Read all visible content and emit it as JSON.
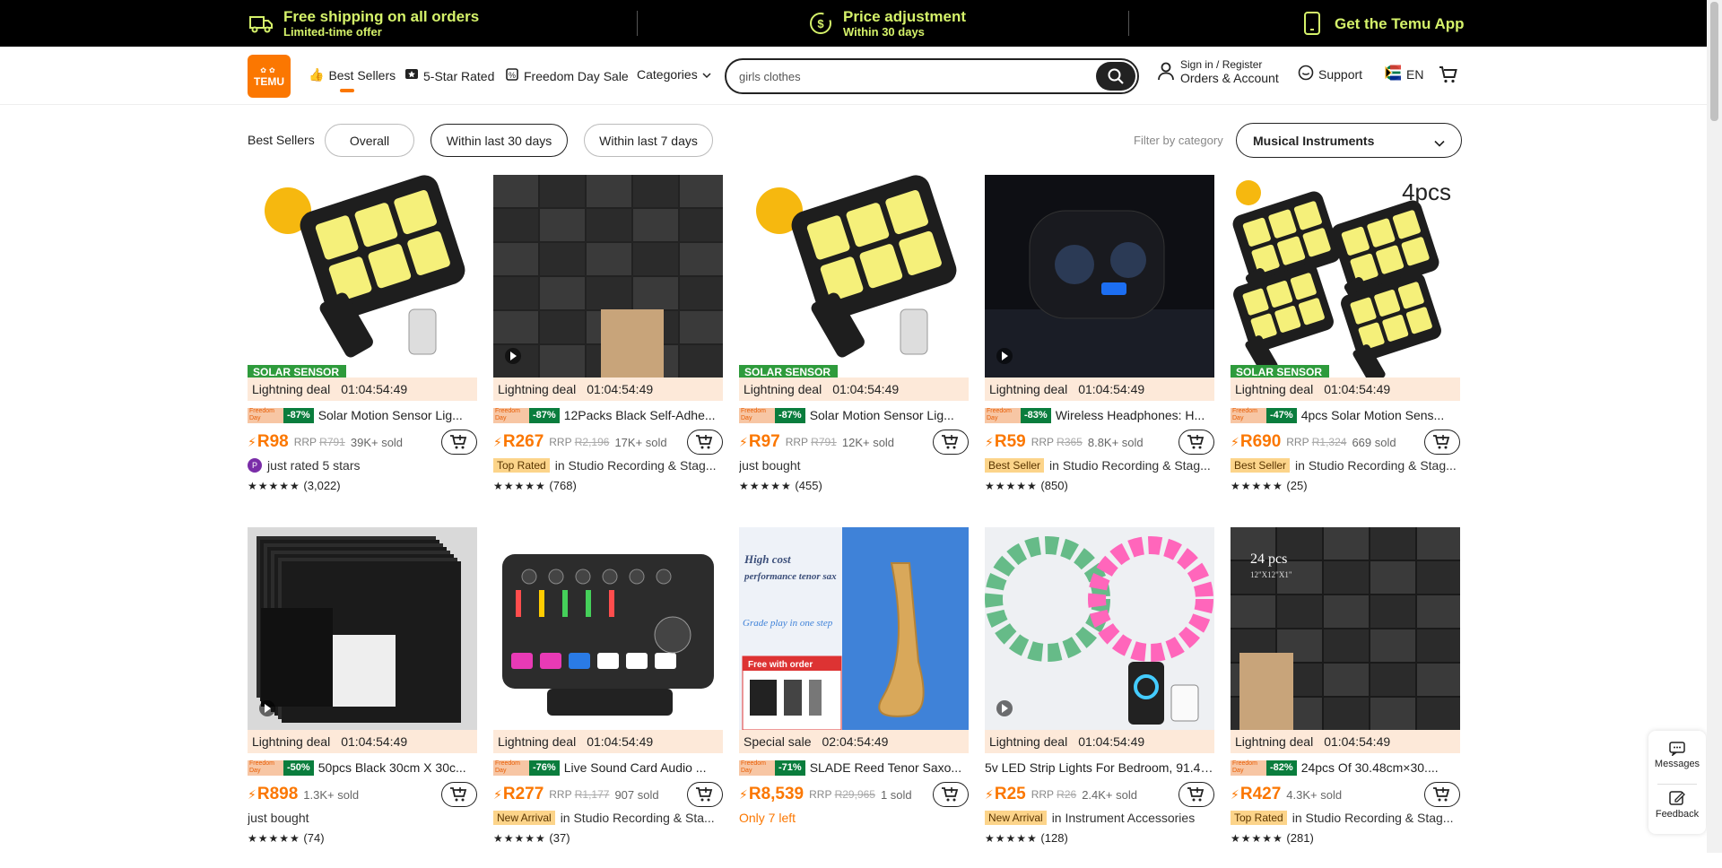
{
  "topbar": {
    "shipping_title": "Free shipping on all orders",
    "shipping_sub": "Limited-time offer",
    "price_title": "Price adjustment",
    "price_sub": "Within 30 days",
    "app": "Get the Temu App"
  },
  "header": {
    "logo_line1": "TE",
    "logo_line2": "MU",
    "nav": [
      "Best Sellers",
      "5-Star Rated",
      "Freedom Day Sale",
      "Categories"
    ],
    "search_value": "girls clothes",
    "signin_line1": "Sign in / Register",
    "signin_line2": "Orders & Account",
    "support": "Support",
    "lang": "EN"
  },
  "filters": {
    "label": "Best Sellers",
    "pills": [
      "Overall",
      "Within last 30 days",
      "Within last 7 days"
    ],
    "filter_label": "Filter by category",
    "category": "Musical Instruments"
  },
  "fd_badge": {
    "line1": "Freedom",
    "line2": "Day"
  },
  "products": [
    {
      "deal": "Lightning deal",
      "timer": "01:04:54:49",
      "disc": "-87%",
      "title": "Solar Motion Sensor Lig...",
      "price": "R98",
      "rrp_label": "RRP",
      "rrp": "R791",
      "sold": "39K+ sold",
      "tag": "",
      "avatar": "P",
      "meta": "just rated 5 stars",
      "stars": "★★★★★",
      "rating": "(3,022)",
      "label": "SOLAR SENSOR"
    },
    {
      "deal": "Lightning deal",
      "timer": "01:04:54:49",
      "disc": "-87%",
      "title": "12Packs Black Self-Adhe...",
      "price": "R267",
      "rrp_label": "RRP",
      "rrp": "R2,196",
      "sold": "17K+ sold",
      "tag": "Top Rated",
      "avatar": "",
      "meta": "in Studio Recording & Stag...",
      "stars": "★★★★★",
      "rating": "(768)",
      "label": ""
    },
    {
      "deal": "Lightning deal",
      "timer": "01:04:54:49",
      "disc": "-87%",
      "title": "Solar Motion Sensor Lig...",
      "price": "R97",
      "rrp_label": "RRP",
      "rrp": "R791",
      "sold": "12K+ sold",
      "tag": "",
      "avatar": "",
      "meta": "just bought",
      "stars": "★★★★★",
      "rating": "(455)",
      "label": "SOLAR SENSOR"
    },
    {
      "deal": "Lightning deal",
      "timer": "01:04:54:49",
      "disc": "-83%",
      "title": "Wireless Headphones: H...",
      "price": "R59",
      "rrp_label": "RRP",
      "rrp": "R365",
      "sold": "8.8K+ sold",
      "tag": "Best Seller",
      "avatar": "",
      "meta": "in Studio Recording & Stag...",
      "stars": "★★★★★",
      "rating": "(850)",
      "label": ""
    },
    {
      "deal": "Lightning deal",
      "timer": "01:04:54:49",
      "disc": "-47%",
      "title": "4pcs Solar Motion Sens...",
      "price": "R690",
      "rrp_label": "RRP",
      "rrp": "R1,324",
      "sold": "669 sold",
      "tag": "Best Seller",
      "avatar": "",
      "meta": "in Studio Recording & Stag...",
      "stars": "★★★★★",
      "rating": "(25)",
      "label": "SOLAR SENSOR",
      "corner": "4pcs"
    },
    {
      "deal": "Lightning deal",
      "timer": "01:04:54:49",
      "disc": "-50%",
      "title": "50pcs Black 30cm X 30c...",
      "price": "R898",
      "rrp_label": "",
      "rrp": "",
      "sold": "1.3K+ sold",
      "tag": "",
      "avatar": "",
      "meta": "just bought",
      "stars": "★★★★★",
      "rating": "(74)",
      "label": ""
    },
    {
      "deal": "Lightning deal",
      "timer": "01:04:54:49",
      "disc": "-76%",
      "title": "Live Sound Card Audio ...",
      "price": "R277",
      "rrp_label": "RRP",
      "rrp": "R1,177",
      "sold": "907 sold",
      "tag": "New Arrival",
      "avatar": "",
      "meta": "in Studio Recording & Sta...",
      "stars": "★★★★★",
      "rating": "(37)",
      "label": ""
    },
    {
      "deal": "Special sale",
      "timer": "02:04:54:49",
      "disc": "-71%",
      "title": "SLADE Reed Tenor Saxo...",
      "price": "R8,539",
      "rrp_label": "RRP",
      "rrp": "R29,965",
      "sold": "1 sold",
      "tag": "",
      "avatar": "",
      "meta": "Only 7 left",
      "stars": "",
      "rating": "",
      "label": "",
      "img_text1": "High cost performance tenor sax",
      "img_text2": "Grade play in one step",
      "img_text3": "Free with order"
    },
    {
      "deal": "Lightning deal",
      "timer": "01:04:54:49",
      "disc": "",
      "title": "5v LED Strip Lights For Bedroom, 91.44...",
      "price": "R25",
      "rrp_label": "RRP",
      "rrp": "R26",
      "sold": "2.4K+ sold",
      "tag": "New Arrival",
      "avatar": "",
      "meta": "in Instrument Accessories",
      "stars": "★★★★★",
      "rating": "(128)",
      "label": ""
    },
    {
      "deal": "Lightning deal",
      "timer": "01:04:54:49",
      "disc": "-82%",
      "title": "24pcs Of 30.48cm×30....",
      "price": "R427",
      "rrp_label": "",
      "rrp": "",
      "sold": "4.3K+ sold",
      "tag": "Top Rated",
      "avatar": "",
      "meta": "in Studio Recording & Stag...",
      "stars": "★★★★★",
      "rating": "(281)",
      "label": "",
      "corner": "24 pcs",
      "corner_sub": "12\"X12\"X1\""
    }
  ],
  "side_widget": {
    "messages": "Messages",
    "feedback": "Feedback"
  },
  "colors": {
    "accent": "#fb7701",
    "topbar_text": "#d5f26a",
    "discount": "#0a7d3d"
  }
}
